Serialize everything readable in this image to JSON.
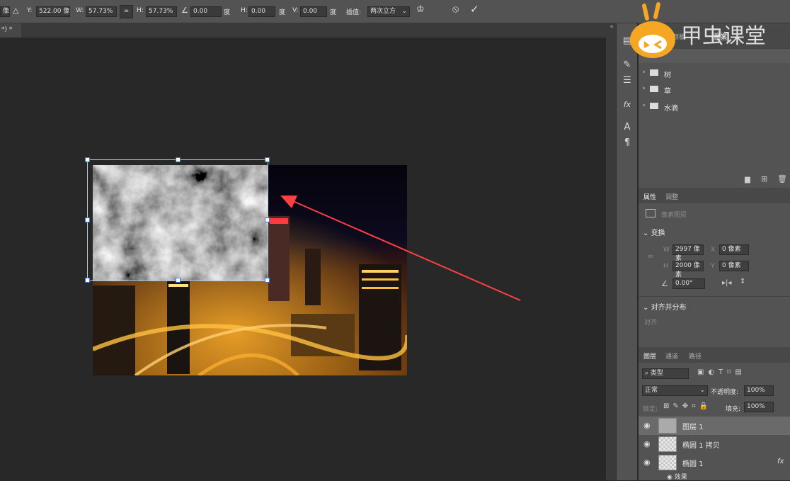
{
  "options_bar": {
    "x_value_unit": "像素",
    "y_label": "Y:",
    "y_value": "522.00 像素",
    "w_label": "W:",
    "w_value": "57.73%",
    "link_icon": "link-icon",
    "h_label": "H:",
    "h_value": "57.73%",
    "rotate_value": "0.00",
    "rotate_unit": "度",
    "skew_h_label": "H:",
    "skew_h_value": "0.00",
    "skew_h_unit": "度",
    "skew_v_label": "V:",
    "skew_v_value": "0.00",
    "skew_v_unit": "度",
    "interp_label": "插值:",
    "interp_value": "两次立方",
    "cancel_icon": "cancel-icon",
    "commit_icon": "checkmark-icon"
  },
  "document_tab": {
    "title": "*) *",
    "close": "×"
  },
  "watermark": {
    "text": "甲虫课堂"
  },
  "panel_collapse": "«",
  "top_panel": {
    "tabs": [
      "颜板",
      "",
      "图案"
    ],
    "folders": [
      "树",
      "草",
      "水滴"
    ]
  },
  "properties": {
    "tabs": [
      "属性",
      "调整"
    ],
    "type_label": "像素图层",
    "transform_title": "变换",
    "w_label": "W",
    "w_value": "2997 像素",
    "x_label": "X",
    "x_value": "0 像素",
    "h_label": "H",
    "h_value": "2000 像素",
    "y_label": "Y",
    "y_value": "0 像素",
    "angle_value": "0.00°",
    "align_title": "对齐并分布",
    "align_label": "对齐:"
  },
  "layers": {
    "tabs": [
      "图层",
      "通道",
      "路径"
    ],
    "filter_placeholder": "类型",
    "blend_mode": "正常",
    "opacity_label": "不透明度:",
    "opacity_value": "100%",
    "lock_label": "锁定:",
    "fill_label": "填充:",
    "fill_value": "100%",
    "items": [
      "图层 1",
      "椭圆 1 拷贝",
      "椭圆 1"
    ],
    "effects_label": "效果",
    "fx_label": "fx"
  },
  "colors": {
    "accent_arrow": "#ff4040",
    "handle_border": "#3874d8"
  }
}
